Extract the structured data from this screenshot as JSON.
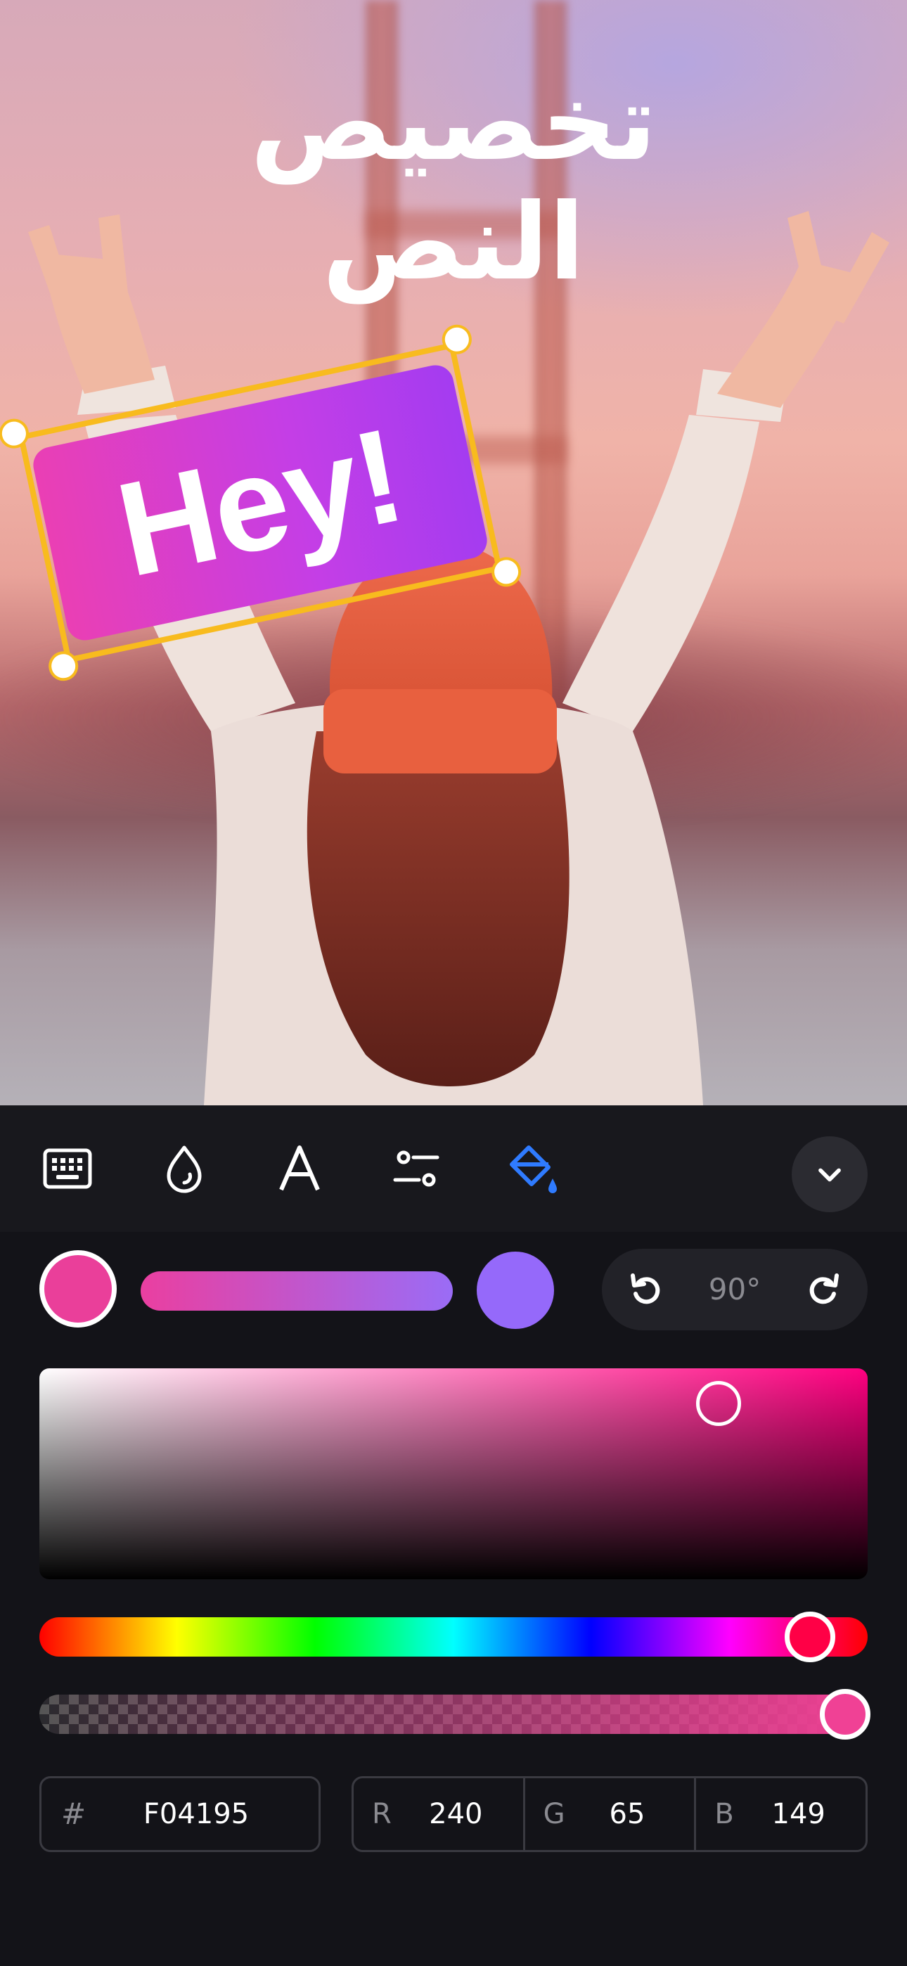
{
  "canvas": {
    "headline_lines": [
      "تخصيص",
      "النص"
    ],
    "sticker_text": "Hey!",
    "sticker_gradient": [
      "#ea3fb4",
      "#a43cf0"
    ],
    "selection_color": "#f8bb1e"
  },
  "toolbar": {
    "tools": [
      {
        "icon": "keyboard-icon",
        "active": false
      },
      {
        "icon": "color-drop-icon",
        "active": false
      },
      {
        "icon": "font-icon",
        "active": false
      },
      {
        "icon": "sliders-icon",
        "active": false
      },
      {
        "icon": "paint-bucket-icon",
        "active": true
      }
    ],
    "active_color": "#2f7bff",
    "collapse_icon": "chevron-down-icon"
  },
  "gradient": {
    "start_color": "#ea3f9a",
    "end_color": "#9569fa",
    "angle_label": "90°"
  },
  "picker": {
    "saturation": 0.82,
    "value": 0.94,
    "hue_position": 0.93,
    "alpha_position": 1.0
  },
  "color_values": {
    "hex_prefix": "#",
    "hex": "F04195",
    "r_label": "R",
    "r": "240",
    "g_label": "G",
    "g": "65",
    "b_label": "B",
    "b": "149"
  }
}
